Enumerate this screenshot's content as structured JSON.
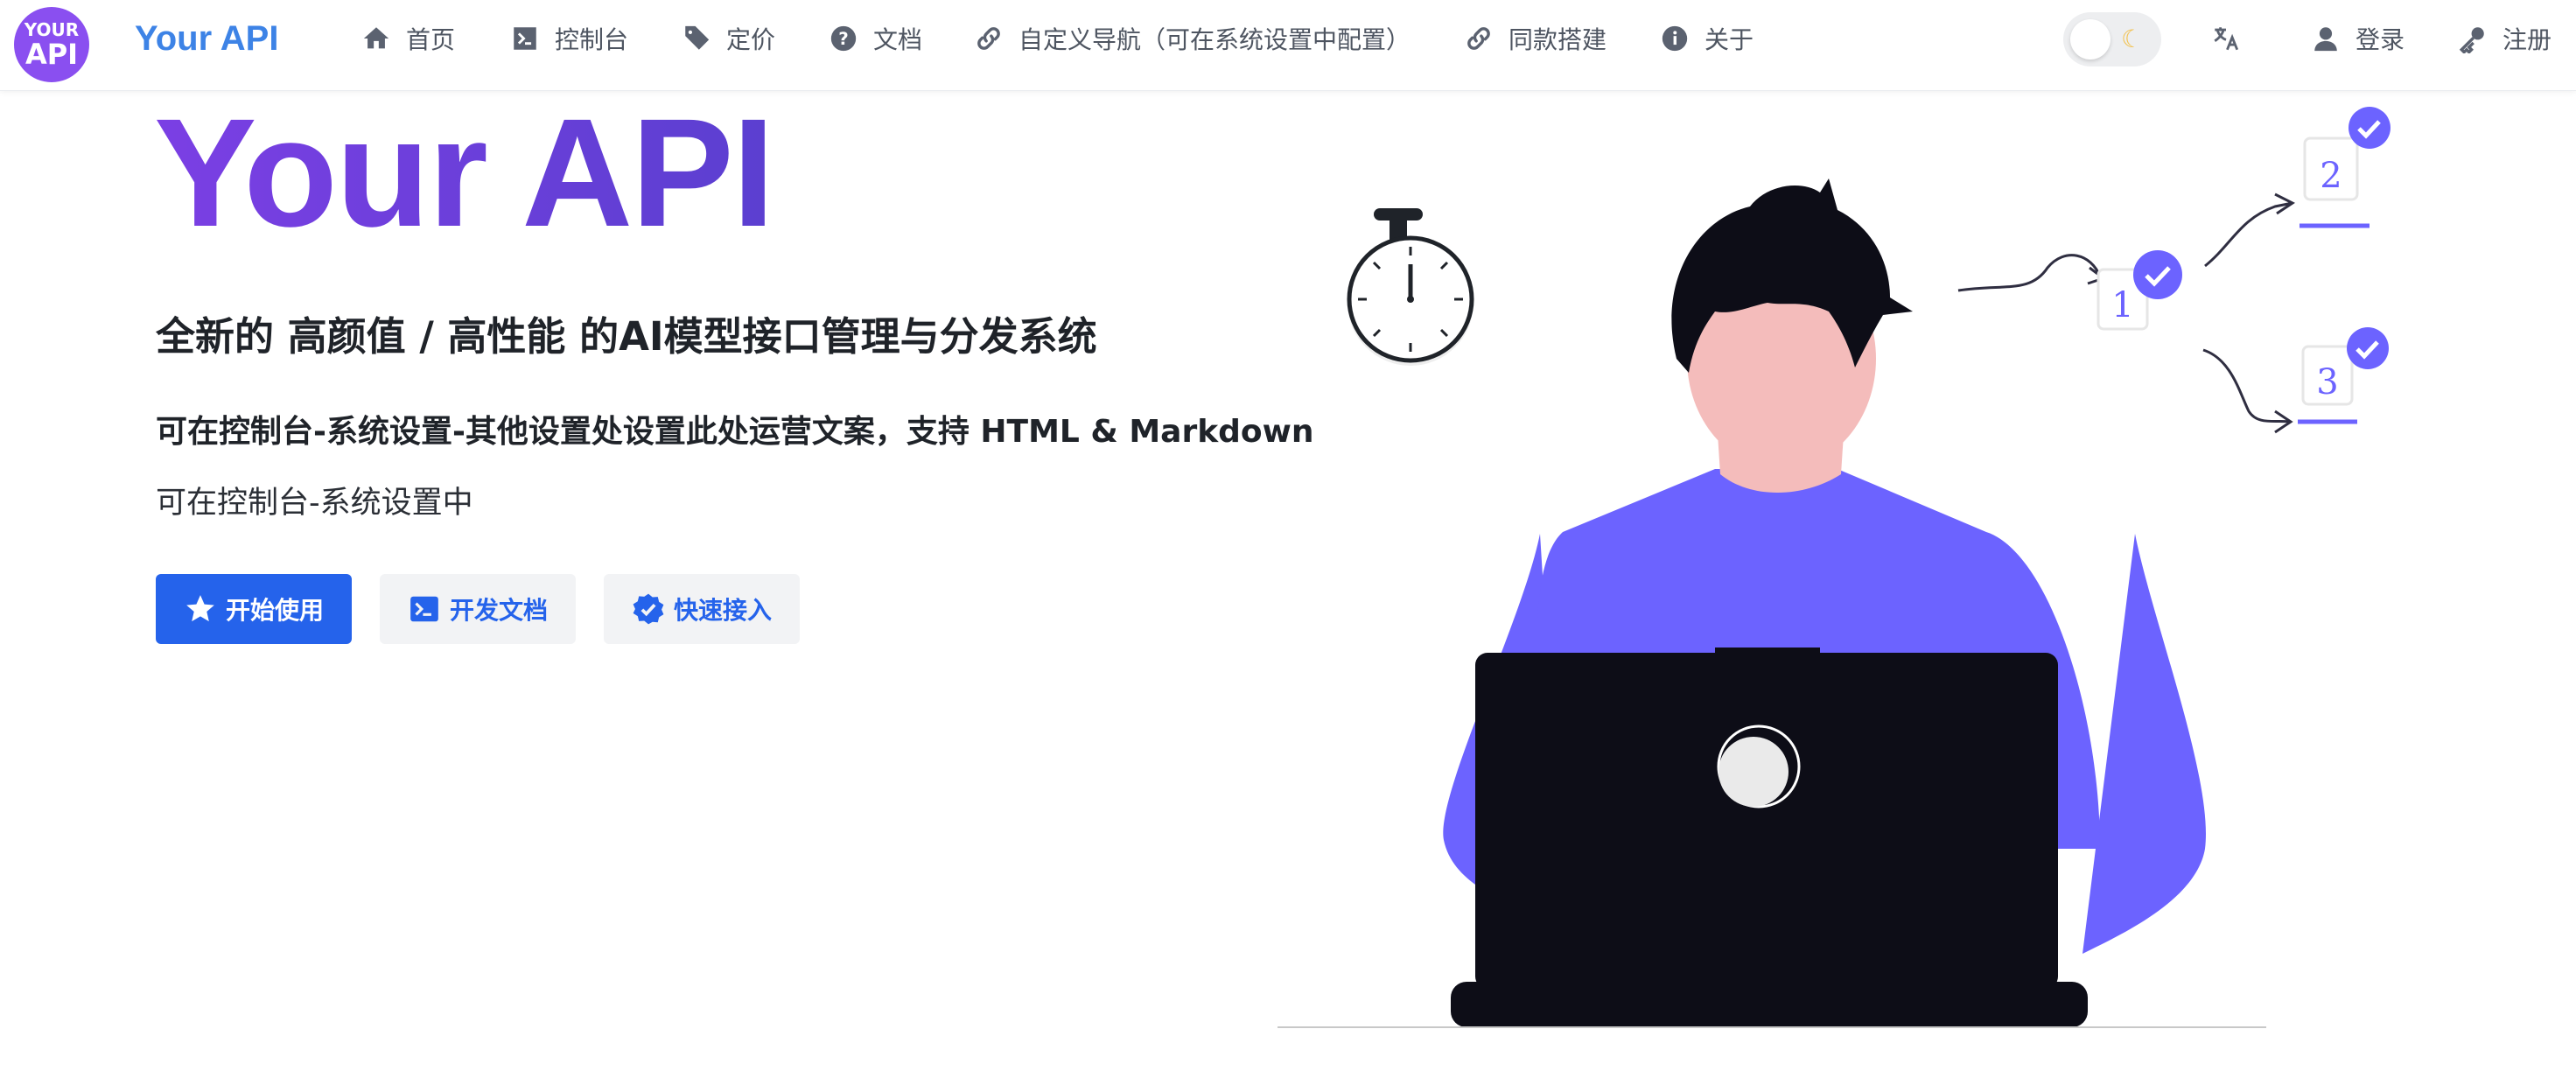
{
  "header": {
    "logo_line1": "YOUR",
    "logo_line2": "API",
    "brand": "Your API",
    "nav": [
      {
        "label": "首页",
        "icon": "home-icon"
      },
      {
        "label": "控制台",
        "icon": "terminal-icon"
      },
      {
        "label": "定价",
        "icon": "tag-icon"
      },
      {
        "label": "文档",
        "icon": "help-circle-icon"
      },
      {
        "label": "自定义导航（可在系统设置中配置）",
        "icon": "link-icon"
      },
      {
        "label": "同款搭建",
        "icon": "link-icon"
      },
      {
        "label": "关于",
        "icon": "info-icon"
      }
    ],
    "theme_toggle_icon": "moon-icon",
    "language_icon": "translate-icon",
    "login_label": "登录",
    "register_label": "注册"
  },
  "hero": {
    "title": "Your API",
    "subtitle": "全新的 高颜值 / 高性能 的AI模型接口管理与分发系统",
    "description": "可在控制台-系统设置-其他设置处设置此处运营文案，支持 HTML & Markdown",
    "note": "可在控制台-系统设置中",
    "buttons": {
      "start": "开始使用",
      "docs": "开发文档",
      "quick": "快速接入"
    }
  },
  "illustration": {
    "steps": [
      "1",
      "2",
      "3"
    ]
  },
  "colors": {
    "brand_blue": "#3d83e6",
    "primary": "#2563eb",
    "title_purple": "#6a3fe0",
    "illustration_purple": "#6c63ff"
  }
}
